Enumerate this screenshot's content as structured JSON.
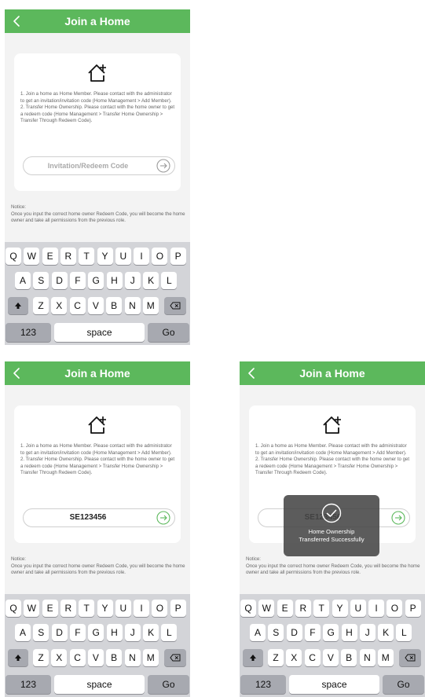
{
  "screens": [
    {
      "title": "Join a Home",
      "instructions": [
        "1. Join a home as Home Member. Please contact with the administrator to get an invitation/invitation code (Home Management > Add Member).",
        "2. Transfer Home Ownership. Please contact with the home owner to get a redeem code (Home Management > Transfer Home Ownership > Transfer Through Redeem Code)."
      ],
      "code_input": {
        "placeholder": "Invitation/Redeem Code",
        "value": ""
      },
      "notice_label": "Notice:",
      "notice_text": "Once you input the correct home owner Redeem Code, you will become the home owner and take all permissions from the previous role."
    },
    {
      "title": "Join a Home",
      "instructions": [
        "1. Join a home as Home Member. Please contact with the administrator to get an invitation/invitation code (Home Management > Add Member).",
        "2. Transfer Home Ownership. Please contact with the home owner to get a redeem code (Home Management > Transfer Home Ownership > Transfer Through Redeem Code)."
      ],
      "code_input": {
        "placeholder": "Invitation/Redeem Code",
        "value": "SE123456"
      },
      "notice_label": "Notice:",
      "notice_text": "Once you input the correct home owner Redeem Code, you will become the home owner and take all permissions from the previous role."
    },
    {
      "title": "Join a Home",
      "instructions": [
        "1. Join a home as Home Member. Please contact with the administrator to get an invitation/invitation code (Home Management > Add Member).",
        "2. Transfer Home Ownership. Please contact with the home owner to get a redeem code (Home Management > Transfer Home Ownership > Transfer Through Redeem Code)."
      ],
      "code_input": {
        "placeholder": "Invitation/Redeem Code",
        "value": "SE123456"
      },
      "notice_label": "Notice:",
      "notice_text": "Once you input the correct home owner Redeem Code, you will become the home owner and take all permissions from the previous role.",
      "toast": {
        "line1": "Home Ownership",
        "line2": "Transferred Successfully",
        "icon": "check-circle-icon"
      }
    }
  ],
  "keyboard": {
    "row1": [
      "Q",
      "W",
      "E",
      "R",
      "T",
      "Y",
      "U",
      "I",
      "O",
      "P"
    ],
    "row2": [
      "A",
      "S",
      "D",
      "F",
      "G",
      "H",
      "J",
      "K",
      "L"
    ],
    "row3": [
      "Z",
      "X",
      "C",
      "V",
      "B",
      "N",
      "M"
    ],
    "shift_icon": "shift-up-arrow-icon",
    "delete_icon": "backspace-icon",
    "numbers_label": "123",
    "space_label": "space",
    "go_label": "Go"
  },
  "colors": {
    "header": "#5cb85c",
    "go_active": "#5cb85c",
    "go_inactive": "#9a9a9a",
    "keyboard_bg": "#d3d4d8"
  }
}
